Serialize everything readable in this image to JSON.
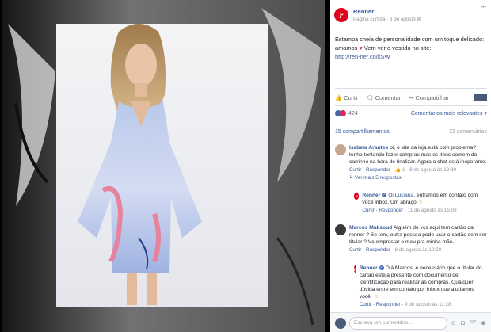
{
  "colors": {
    "brand": "#e2001a",
    "link": "#365899",
    "muted": "#90949c",
    "heart": "#e0245e"
  },
  "post": {
    "page_name": "Renner",
    "page_type": "Página curtida",
    "date": "8 de agosto",
    "text_1": "Estampa cheia de personalidade com um toque delicado: amamos",
    "text_2": "Vem ver o vestido no site:",
    "link": "http://ren-ner.co/kSW",
    "heart_icon": "heart-icon"
  },
  "actions": {
    "like": "Curtir",
    "comment": "Comentar",
    "share": "Compartilhar"
  },
  "stats": {
    "reactions_count": "424",
    "relevance": "Comentários mais relevantes",
    "shares": "15 compartilhamentos",
    "comments": "22 comentários"
  },
  "comments": [
    {
      "author": "Isabela Arantes",
      "text": "oi, o site da loja está com problema? tenho tentando fazer compras mas os itens somem do carrinho na hora de finalizar. Agora o chat está inoperante.",
      "like": "Curtir",
      "reply": "Responder",
      "likes": "1",
      "date": "8 de agosto às 18:39",
      "more_replies": "Ver mais 5 respostas"
    },
    {
      "author": "Renner",
      "mention": "Oi Luciana,",
      "text": "entramos em contato com você inbox. Um abraço",
      "like": "Curtir",
      "reply": "Responder",
      "date": "11 de agosto às 15:03"
    },
    {
      "author": "Marcos Maksoud",
      "text": "Alguém de vcs aqui tem cartão da renner ? Se tem, outra pessoa pode usar o cartão sem ser titular ? Vc emprestar o meu pra minha mãe.",
      "like": "Curtir",
      "reply": "Responder",
      "date": "8 de agosto às 19:20"
    },
    {
      "author": "Renner",
      "text": "Olá Marcos, é necessário que o titular do cartão esteja presente com documento de identificação para realizar as compras. Qualquer dúvida entre em contato por inbox que ajudamos você.",
      "like": "Curtir",
      "reply": "Responder",
      "date": "9 de agosto às 11:28"
    }
  ],
  "composer": {
    "placeholder": "Escreva um comentário..."
  }
}
